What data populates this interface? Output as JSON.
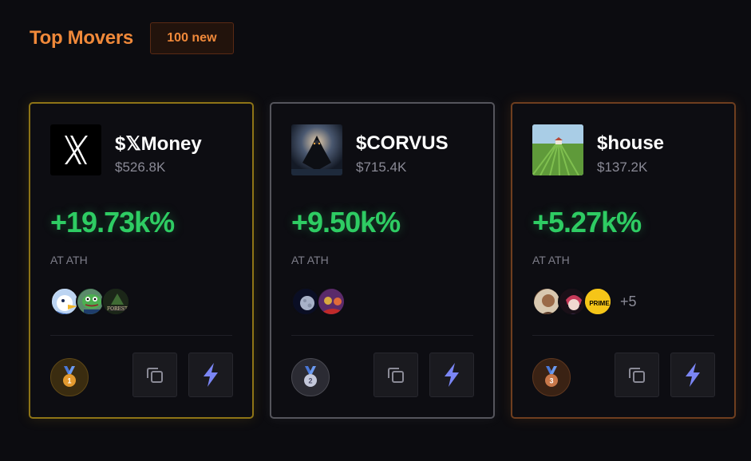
{
  "header": {
    "title": "Top Movers",
    "badge": "100 new"
  },
  "cards": [
    {
      "rank": "1",
      "name": "$𝕏Money",
      "market_cap": "$526.8K",
      "change": "+19.73k%",
      "status": "AT ATH",
      "logo": "x-logo-icon",
      "medal": "gold-medal-icon",
      "holders": [
        "duck-avatar",
        "pepe-avatar",
        "forest-avatar"
      ],
      "more_holders": ""
    },
    {
      "rank": "2",
      "name": "$CORVUS",
      "market_cap": "$715.4K",
      "change": "+9.50k%",
      "status": "AT ATH",
      "logo": "raven-logo-icon",
      "medal": "silver-medal-icon",
      "holders": [
        "moon-avatar",
        "crowd-avatar"
      ],
      "more_holders": ""
    },
    {
      "rank": "3",
      "name": "$house",
      "market_cap": "$137.2K",
      "change": "+5.27k%",
      "status": "AT ATH",
      "logo": "house-field-logo-icon",
      "medal": "bronze-medal-icon",
      "holders": [
        "portrait-avatar",
        "anime-avatar",
        "prime-avatar"
      ],
      "more_holders": "+5",
      "prime_label": "PRIME"
    }
  ],
  "actions": {
    "copy_icon": "copy-icon",
    "quick_buy_icon": "lightning-icon"
  },
  "colors": {
    "accent": "#f0893a",
    "positive": "#2ecc63",
    "gold": "#8e7416",
    "silver": "#55555c",
    "bronze": "#6f3e1f",
    "bolt": "#7b86f5"
  }
}
